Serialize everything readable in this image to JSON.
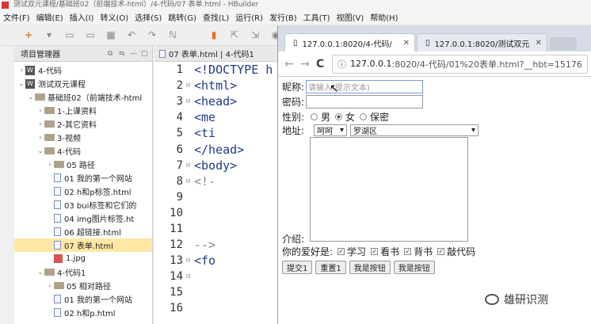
{
  "app": {
    "title": "测试双元课程/基础班02（前端技术-html）/4-代码/07 表单.html - HBuilder"
  },
  "menu": [
    "文件(F)",
    "编辑(E)",
    "插入(I)",
    "转义(O)",
    "选择(S)",
    "跳转(G)",
    "查找(L)",
    "运行(R)",
    "发行(B)",
    "工具(T)",
    "视图(V)",
    "帮助(H)"
  ],
  "project": {
    "header": "项目管理器",
    "items": [
      {
        "label": "4-代码"
      },
      {
        "label": "测试双元课程"
      },
      {
        "label": "基础班02（前端技术-html"
      },
      {
        "label": "1-上课资料"
      },
      {
        "label": "2-其它资料"
      },
      {
        "label": "3-视频"
      },
      {
        "label": "4-代码"
      },
      {
        "label": "05 路径"
      },
      {
        "label": "01 我的第一个网站"
      },
      {
        "label": "02 h和p标签.html"
      },
      {
        "label": "03 bui标签和它们的"
      },
      {
        "label": "04 img图片标签.ht"
      },
      {
        "label": "06 超链接.html"
      },
      {
        "label": "07 表单.html"
      },
      {
        "label": "1.jpg"
      },
      {
        "label": "4-代码1"
      },
      {
        "label": "05 相对路径"
      },
      {
        "label": "01 我的第一个网站"
      },
      {
        "label": "02 h和p.html"
      }
    ]
  },
  "editor": {
    "tab": "07 表单.html | 4-代码1",
    "lines": [
      {
        "n": "1",
        "code": "<!DOCTYPE h"
      },
      {
        "n": "2",
        "code": "<html>"
      },
      {
        "n": "3",
        "code": "    <head>"
      },
      {
        "n": "4",
        "code": "        <me"
      },
      {
        "n": "5",
        "code": "        <ti"
      },
      {
        "n": "6",
        "code": "    </head>"
      },
      {
        "n": "7",
        "code": "    <body>"
      },
      {
        "n": "8",
        "code": "        <!-"
      },
      {
        "n": "9",
        "code": ""
      },
      {
        "n": "10",
        "code": ""
      },
      {
        "n": "11",
        "code": ""
      },
      {
        "n": "12",
        "code": "        -->"
      },
      {
        "n": "13",
        "code": "        <fo"
      },
      {
        "n": "14",
        "code": ""
      },
      {
        "n": "15",
        "code": ""
      },
      {
        "n": "16",
        "code": ""
      }
    ]
  },
  "browser": {
    "tab1": "127.0.0.1:8020/4-代码/",
    "tab2": "127.0.0.1:8020/测试双元",
    "url_domain": "127.0.0.1",
    "url_path": ":8020/4-代码/01%20表单.html?__hbt=15176"
  },
  "form": {
    "nickname_label": "昵称:",
    "nickname_placeholder": "请输入(提示文本)",
    "password_label": "密码:",
    "gender_label": "性别:",
    "gender_male": "男",
    "gender_female": "女",
    "gender_secret": "保密",
    "address_label": "地址:",
    "address_city": "呵呵",
    "address_district": "罗湖区",
    "intro_label": "介绍:",
    "hobby_label": "你的爱好是:",
    "hobby_1": "学习",
    "hobby_2": "看书",
    "hobby_3": "背书",
    "hobby_4": "敲代码",
    "btn_submit": "提交1",
    "btn_reset": "重置1",
    "btn_button1": "我是按钮",
    "btn_button2": "我是按钮"
  },
  "watermark": "雄研识测"
}
